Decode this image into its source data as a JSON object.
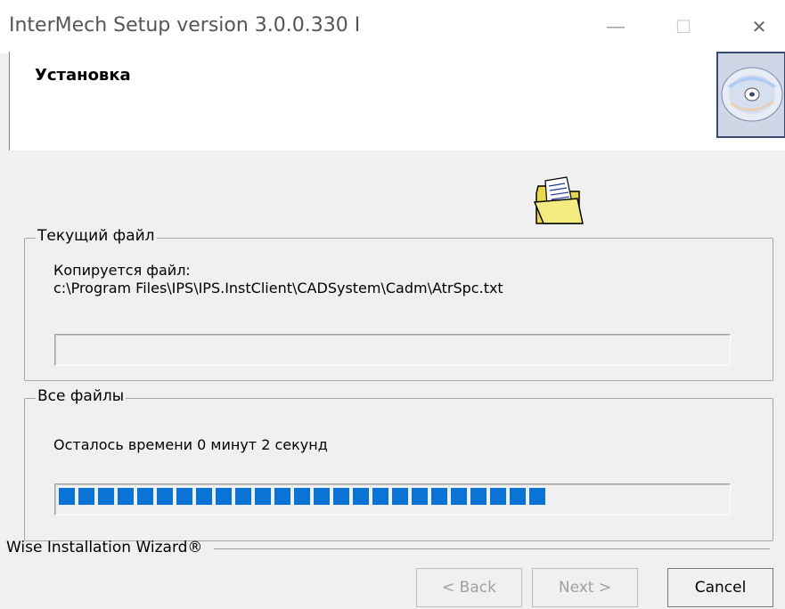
{
  "window": {
    "title": "InterMech Setup version 3.0.0.330 I",
    "minimize_glyph": "—",
    "maximize_glyph": "☐",
    "close_glyph": "✕"
  },
  "header": {
    "title": "Установка",
    "icon": "cd-disc-icon"
  },
  "current_file": {
    "legend": "Текущий файл",
    "status": "Копируется файл:",
    "path": "c:\\Program Files\\IPS\\IPS.InstClient\\CADSystem\\Cadm\\AtrSpc.txt",
    "progress": 0
  },
  "all_files": {
    "legend": "Все файлы",
    "time_remaining": "Осталось времени 0 минут 2 секунд",
    "progress_blocks_filled": 25
  },
  "footer": {
    "brand": "Wise Installation Wizard®",
    "back_label": "< Back",
    "next_label": "Next >",
    "cancel_label": "Cancel"
  },
  "colors": {
    "progress_fill": "#0a74d6",
    "background": "#f0f0f0"
  }
}
